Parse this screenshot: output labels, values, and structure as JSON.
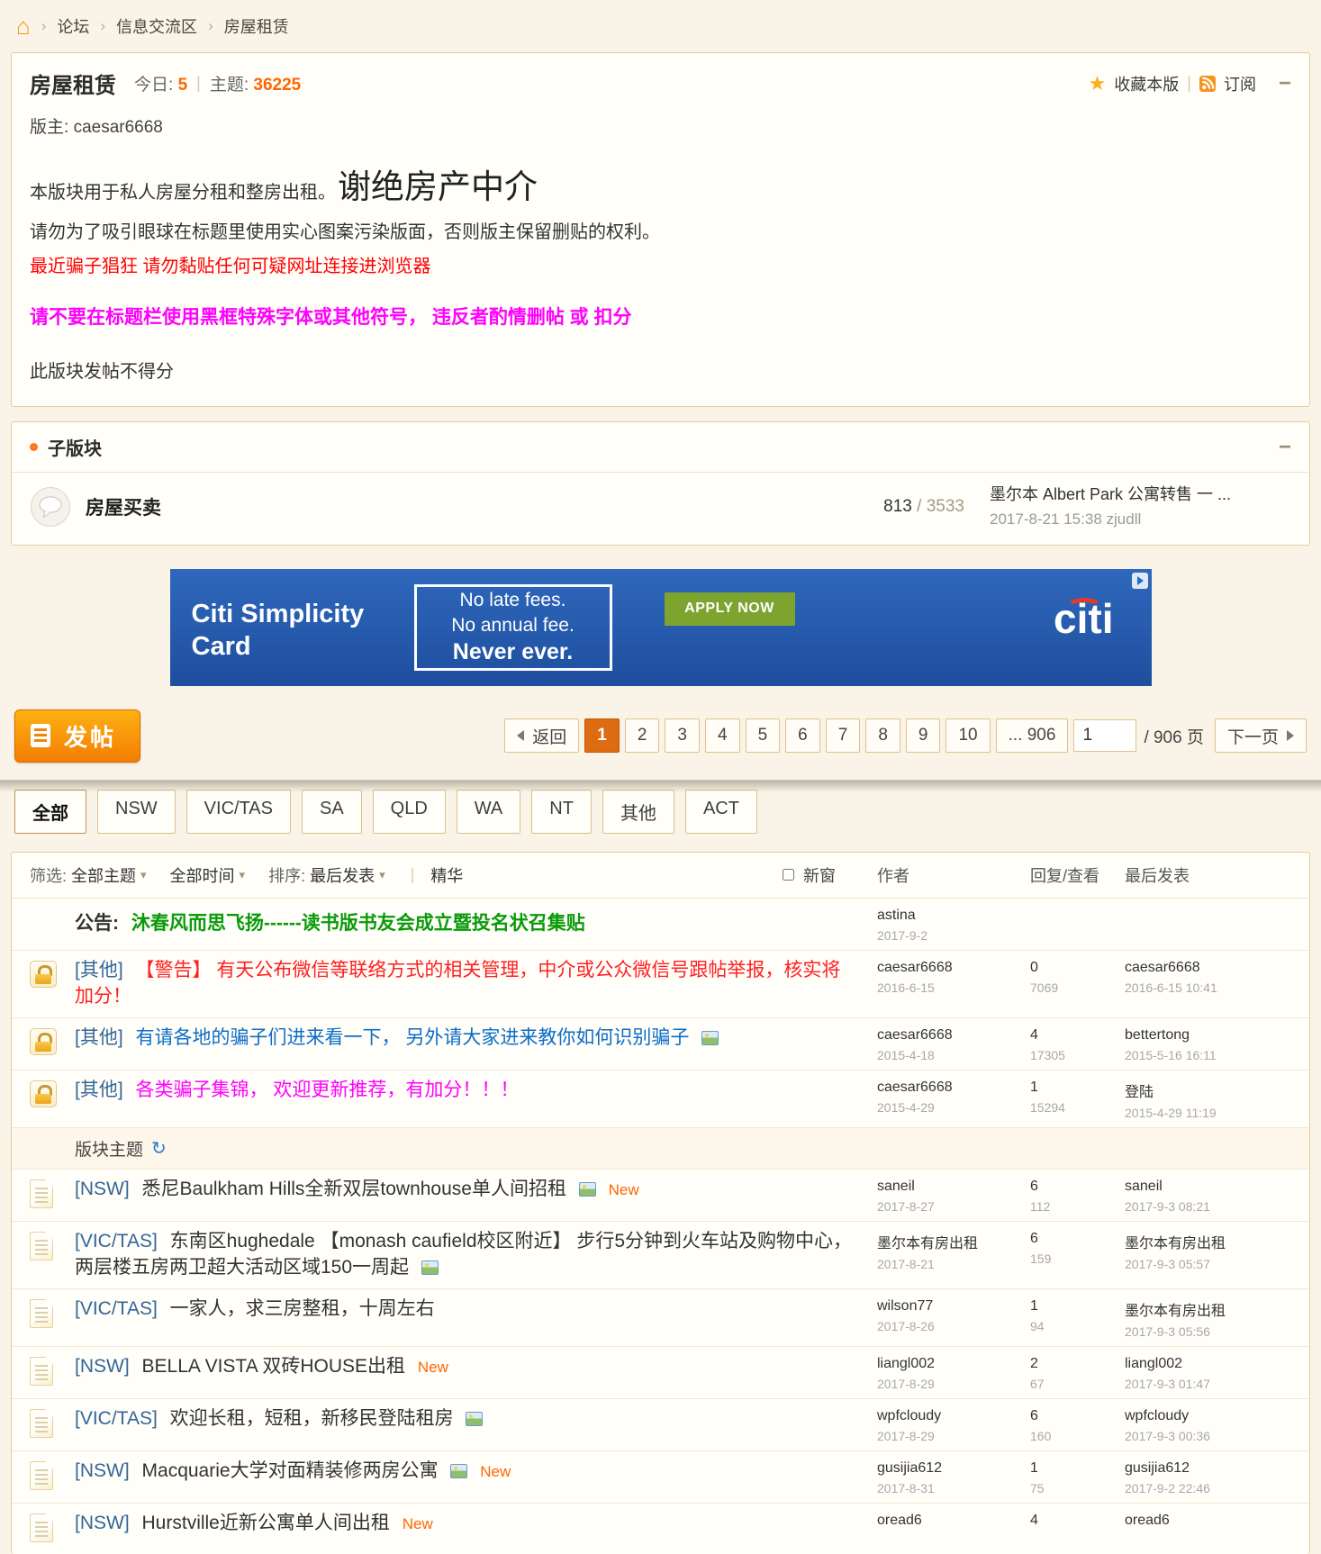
{
  "colors": {
    "accent_orange": "#FF6600",
    "link_blue": "#336699",
    "sticky_red": "#FF2020",
    "sticky_blue": "#0C6DC7",
    "sticky_magenta": "#FF00FF",
    "announcement_green": "#0A9A0A",
    "ad_background_blue": "#2A5DB0",
    "ad_button_green": "#7CA42E",
    "page_background": "#F9F4E7"
  },
  "breadcrumb": {
    "items": [
      "论坛",
      "信息交流区",
      "房屋租赁"
    ]
  },
  "forum_header": {
    "title": "房屋租赁",
    "today_label": "今日:",
    "today_count": "5",
    "topics_label": "主题:",
    "topics_count": "36225",
    "favorite_label": "收藏本版",
    "subscribe_label": "订阅",
    "moderator_label": "版主:",
    "moderator_name": "caesar6668",
    "desc_intro": "本版块用于私人房屋分租和整房出租。",
    "desc_highlight": "谢绝房产中介",
    "desc_rule1": "请勿为了吸引眼球在标题里使用实心图案污染版面，否则版主保留删贴的权利。",
    "desc_warning_red": "最近骗子猖狂 请勿黏贴任何可疑网址连接进浏览器",
    "desc_warning_magenta": "请不要在标题栏使用黑框特殊字体或其他符号， 违反者酌情删帖 或 扣分",
    "desc_note": "此版块发帖不得分"
  },
  "subforum_section": {
    "title": "子版块",
    "forum_name": "房屋买卖",
    "topic_count": "813",
    "count_separator": "/",
    "post_count": "3533",
    "last_post_title": "墨尔本 Albert Park 公寓转售 一 ...",
    "last_post_time": "2017-8-21 15:38",
    "last_post_user": "zjudll"
  },
  "ad_banner": {
    "brand_line1": "Citi Simplicity",
    "brand_line2": "Card",
    "tagline1": "No late fees.",
    "tagline2": "No annual fee.",
    "tagline3": "Never ever.",
    "cta_label": "APPLY NOW",
    "logo_text": "citi"
  },
  "toolbar": {
    "post_button_label": "发帖",
    "back_label": "返回",
    "pages": [
      {
        "label": "1",
        "state": "active"
      },
      {
        "label": "2"
      },
      {
        "label": "3"
      },
      {
        "label": "4"
      },
      {
        "label": "5"
      },
      {
        "label": "6"
      },
      {
        "label": "7"
      },
      {
        "label": "8"
      },
      {
        "label": "9"
      },
      {
        "label": "10"
      }
    ],
    "ellipsis_label": "... 906",
    "jump_value": "1",
    "total_pages_label": "/ 906 页",
    "next_label": "下一页"
  },
  "region_tabs": [
    {
      "label": "全部",
      "state": "active"
    },
    {
      "label": "NSW"
    },
    {
      "label": "VIC/TAS"
    },
    {
      "label": "SA"
    },
    {
      "label": "QLD"
    },
    {
      "label": "WA"
    },
    {
      "label": "NT"
    },
    {
      "label": "其他"
    },
    {
      "label": "ACT"
    }
  ],
  "filter_bar": {
    "filter_label": "筛选:",
    "topic_filter": "全部主题",
    "time_filter": "全部时间",
    "sort_label": "排序:",
    "sort_value": "最后发表",
    "digest_label": "精华",
    "new_window_label": "新窗",
    "col_author": "作者",
    "col_reply_view": "回复/查看",
    "col_last_post": "最后发表"
  },
  "announcement": {
    "label": "公告:",
    "title": "沐春风而思飞扬------读书版书友会成立暨投名状召集贴",
    "author": "astina",
    "date": "2017-9-2"
  },
  "section_divider": {
    "label": "版块主题"
  },
  "sticky_threads": [
    {
      "icon": "lock",
      "tag": "[其他]",
      "title": "【警告】 有天公布微信等联络方式的相关管理，中介或公众微信号跟帖举报，核实将加分！",
      "color": "red",
      "author": "caesar6668",
      "date": "2016-6-15",
      "replies": "0",
      "views": "7069",
      "last_user": "caesar6668",
      "last_date": "2016-6-15 10:41"
    },
    {
      "icon": "lock",
      "tag": "[其他]",
      "title": "有请各地的骗子们进来看一下， 另外请大家进来教你如何识别骗子",
      "color": "blue",
      "attach": true,
      "author": "caesar6668",
      "date": "2015-4-18",
      "replies": "4",
      "views": "17305",
      "last_user": "bettertong",
      "last_date": "2015-5-16 16:11"
    },
    {
      "icon": "lock",
      "tag": "[其他]",
      "title": "各类骗子集锦， 欢迎更新推荐，有加分！！！",
      "color": "magenta",
      "author": "caesar6668",
      "date": "2015-4-29",
      "replies": "1",
      "views": "15294",
      "last_user": "登陆",
      "last_date": "2015-4-29 11:19"
    }
  ],
  "threads": [
    {
      "icon": "page",
      "tag": "[NSW]",
      "title": "悉尼Baulkham Hills全新双层townhouse单人间招租",
      "attach": true,
      "is_new": "New",
      "author": "saneil",
      "date": "2017-8-27",
      "replies": "6",
      "views": "112",
      "last_user": "saneil",
      "last_date": "2017-9-3 08:21"
    },
    {
      "icon": "page",
      "tag": "[VIC/TAS]",
      "title": "东南区hughedale 【monash caufield校区附近】 步行5分钟到火车站及购物中心，两层楼五房两卫超大活动区域150一周起",
      "attach": true,
      "author": "墨尔本有房出租",
      "date": "2017-8-21",
      "replies": "6",
      "views": "159",
      "last_user": "墨尔本有房出租",
      "last_date": "2017-9-3 05:57"
    },
    {
      "icon": "page",
      "tag": "[VIC/TAS]",
      "title": "一家人，求三房整租，十周左右",
      "author": "wilson77",
      "date": "2017-8-26",
      "replies": "1",
      "views": "94",
      "last_user": "墨尔本有房出租",
      "last_date": "2017-9-3 05:56"
    },
    {
      "icon": "page",
      "tag": "[NSW]",
      "title": "BELLA VISTA 双砖HOUSE出租",
      "is_new": "New",
      "author": "liangl002",
      "date": "2017-8-29",
      "replies": "2",
      "views": "67",
      "last_user": "liangl002",
      "last_date": "2017-9-3 01:47"
    },
    {
      "icon": "page",
      "tag": "[VIC/TAS]",
      "title": "欢迎长租，短租，新移民登陆租房",
      "attach": true,
      "author": "wpfcloudy",
      "date": "2017-8-29",
      "replies": "6",
      "views": "160",
      "last_user": "wpfcloudy",
      "last_date": "2017-9-3 00:36"
    },
    {
      "icon": "page",
      "tag": "[NSW]",
      "title": "Macquarie大学对面精装修两房公寓",
      "attach": true,
      "is_new": "New",
      "author": "gusijia612",
      "date": "2017-8-31",
      "replies": "1",
      "views": "75",
      "last_user": "gusijia612",
      "last_date": "2017-9-2 22:46"
    },
    {
      "icon": "page",
      "tag": "[NSW]",
      "title": "Hurstville近新公寓单人间出租",
      "is_new": "New",
      "author": "oread6",
      "date": "",
      "replies": "4",
      "views": "",
      "last_user": "oread6",
      "last_date": ""
    }
  ]
}
